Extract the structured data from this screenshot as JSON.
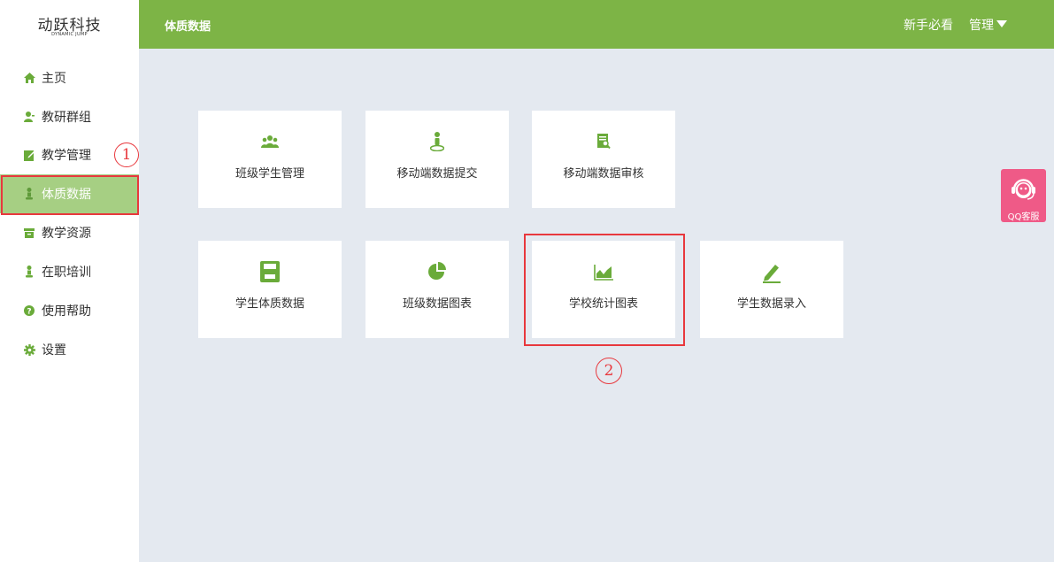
{
  "brand": {
    "name": "动跃科技",
    "sub": "DYNAMIC JUMP"
  },
  "sidebar": {
    "items": [
      {
        "label": "主页",
        "icon": "home-icon"
      },
      {
        "label": "教研群组",
        "icon": "user-icon"
      },
      {
        "label": "教学管理",
        "icon": "edit-icon"
      },
      {
        "label": "体质数据",
        "icon": "person-icon",
        "active": true
      },
      {
        "label": "教学资源",
        "icon": "archive-icon"
      },
      {
        "label": "在职培训",
        "icon": "person-icon"
      },
      {
        "label": "使用帮助",
        "icon": "question-icon"
      },
      {
        "label": "设置",
        "icon": "gear-icon"
      }
    ]
  },
  "header": {
    "title": "体质数据",
    "guide": "新手必看",
    "manage": "管理"
  },
  "cards": [
    {
      "label": "班级学生管理",
      "icon": "group-icon"
    },
    {
      "label": "移动端数据提交",
      "icon": "person-pin-icon"
    },
    {
      "label": "移动端数据审核",
      "icon": "doc-search-icon"
    },
    {
      "label": "学生体质数据",
      "icon": "save-icon"
    },
    {
      "label": "班级数据图表",
      "icon": "pie-chart-icon"
    },
    {
      "label": "学校统计图表",
      "icon": "area-chart-icon"
    },
    {
      "label": "学生数据录入",
      "icon": "pencil-icon"
    }
  ],
  "annotations": {
    "step1": "1",
    "step2": "2"
  },
  "qq_service": {
    "label": "QQ客服"
  },
  "colors": {
    "accent": "#7db446",
    "active_bg": "#a6cf83",
    "highlight": "#e8383d",
    "qq": "#ef5a87"
  }
}
